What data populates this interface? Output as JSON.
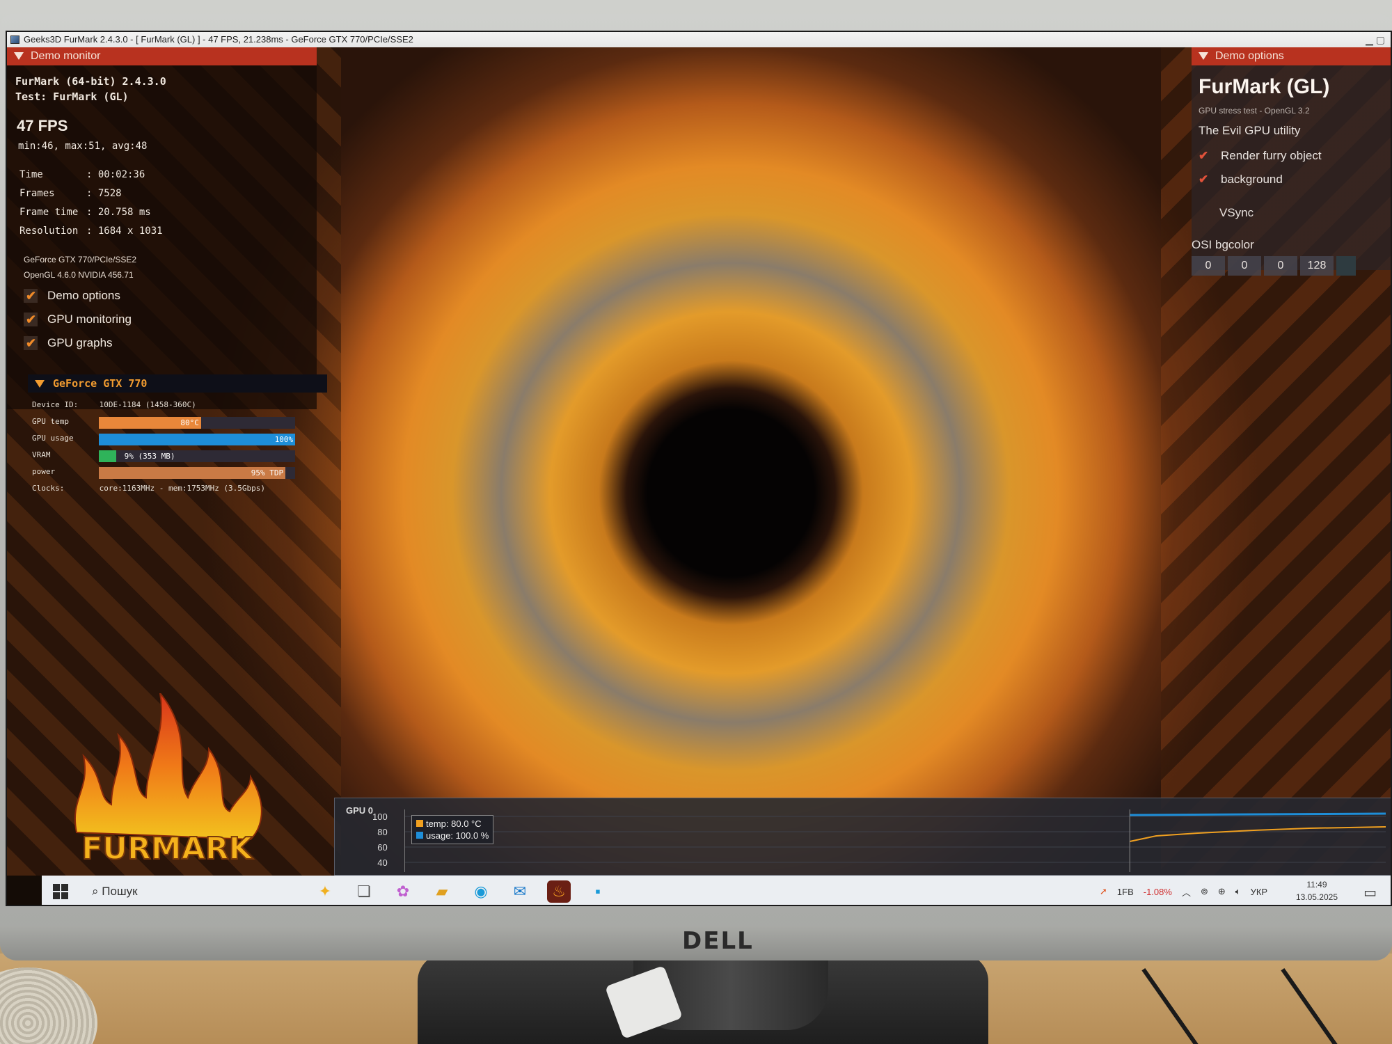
{
  "window": {
    "title": "Geeks3D FurMark 2.4.3.0 - [ FurMark (GL) ] - 47 FPS, 21.238ms - GeForce GTX 770/PCIe/SSE2"
  },
  "demo_monitor": {
    "header": "Demo monitor",
    "app_line": "FurMark (64-bit) 2.4.3.0",
    "test_line": "Test: FurMark (GL)",
    "fps": "47 FPS",
    "minmax": "min:46, max:51, avg:48",
    "stats": [
      {
        "label": "Time",
        "value": ": 00:02:36"
      },
      {
        "label": "Frames",
        "value": ": 7528"
      },
      {
        "label": "Frame time",
        "value": ": 20.758 ms"
      },
      {
        "label": "Resolution",
        "value": ": 1684 x 1031"
      }
    ],
    "gpu_name": "GeForce GTX 770/PCIe/SSE2",
    "opengl": "OpenGL 4.6.0 NVIDIA 456.71",
    "checks": [
      {
        "label": "Demo options",
        "checked": true
      },
      {
        "label": "GPU monitoring",
        "checked": true
      },
      {
        "label": "GPU graphs",
        "checked": true
      }
    ]
  },
  "gpu_panel": {
    "header": "GeForce GTX 770",
    "device_id_label": "Device ID:",
    "device_id": "10DE-1184 (1458-360C)",
    "rows": [
      {
        "label": "GPU temp",
        "text": "80°C",
        "fraction": 0.52,
        "color": "#e8873a"
      },
      {
        "label": "GPU usage",
        "text": "100%",
        "fraction": 1.0,
        "color": "#1e8ed8"
      },
      {
        "label": "VRAM",
        "text": "9% (353 MB)",
        "fraction": 0.09,
        "color": "#2fb35a"
      },
      {
        "label": "power",
        "text": "95% TDP",
        "fraction": 0.95,
        "color": "#c97a45"
      }
    ],
    "clocks_label": "Clocks:",
    "clocks": "core:1163MHz - mem:1753MHz (3.5Gbps)"
  },
  "logo": {
    "text": "FURMARK"
  },
  "demo_options": {
    "header": "Demo options",
    "title": "FurMark (GL)",
    "subtitle": "GPU stress test - OpenGL 3.2",
    "tagline": "The Evil GPU utility",
    "checks": [
      {
        "label": "Render furry object",
        "checked": true
      },
      {
        "label": "background",
        "checked": true
      }
    ],
    "vsync": "VSync",
    "bgcolor_label": "OSI bgcolor",
    "bgcolor_values": [
      "0",
      "0",
      "0",
      "128"
    ]
  },
  "graph": {
    "label": "GPU 0",
    "axis": [
      "100",
      "80",
      "60",
      "40"
    ],
    "legend": [
      {
        "name": "temp: 80.0 °C",
        "color": "#f0a020"
      },
      {
        "name": "usage: 100.0 %",
        "color": "#1e8ed8"
      }
    ]
  },
  "taskbar": {
    "search": "Пошук",
    "stock": "1FB",
    "stock_change": "-1.08%",
    "lang": "УКР",
    "time": "11:49",
    "date": "13.05.2025"
  },
  "monitor": {
    "brand": "DELL"
  }
}
